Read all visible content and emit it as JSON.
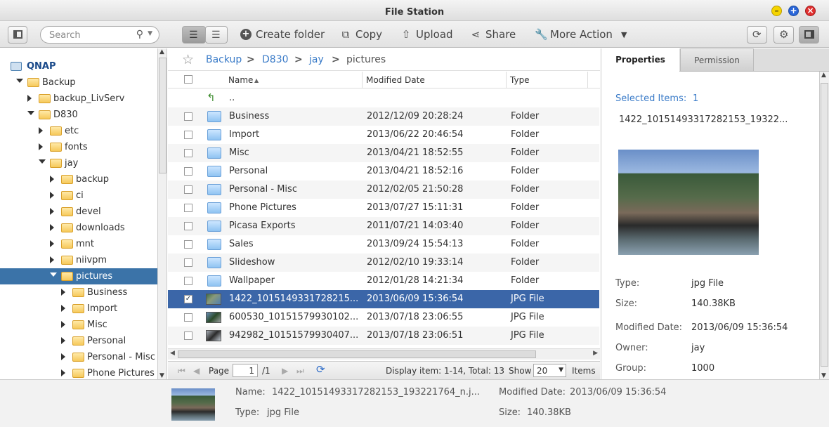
{
  "window": {
    "title": "File Station"
  },
  "toolbar": {
    "search_placeholder": "Search",
    "create_folder": "Create folder",
    "copy": "Copy",
    "upload": "Upload",
    "share": "Share",
    "more_action": "More Action"
  },
  "tree": {
    "root": "QNAP",
    "items": [
      {
        "label": "Backup"
      },
      {
        "label": "backup_LivServ"
      },
      {
        "label": "D830"
      },
      {
        "label": "etc"
      },
      {
        "label": "fonts"
      },
      {
        "label": "jay"
      },
      {
        "label": "backup"
      },
      {
        "label": "ci"
      },
      {
        "label": "devel"
      },
      {
        "label": "downloads"
      },
      {
        "label": "mnt"
      },
      {
        "label": "niivpm"
      },
      {
        "label": "pictures"
      },
      {
        "label": "Business"
      },
      {
        "label": "Import"
      },
      {
        "label": "Misc"
      },
      {
        "label": "Personal"
      },
      {
        "label": "Personal - Misc"
      },
      {
        "label": "Phone Pictures"
      }
    ]
  },
  "breadcrumb": [
    "Backup",
    "D830",
    "jay",
    "pictures"
  ],
  "breadcrumb_sep": ">",
  "table": {
    "headers": {
      "name": "Name",
      "modified": "Modified Date",
      "type": "Type"
    },
    "parent": "..",
    "rows": [
      {
        "name": "Business",
        "modified": "2012/12/09 20:28:24",
        "type": "Folder"
      },
      {
        "name": "Import",
        "modified": "2013/06/22 20:46:54",
        "type": "Folder"
      },
      {
        "name": "Misc",
        "modified": "2013/04/21 18:52:55",
        "type": "Folder"
      },
      {
        "name": "Personal",
        "modified": "2013/04/21 18:52:16",
        "type": "Folder"
      },
      {
        "name": "Personal - Misc",
        "modified": "2012/02/05 21:50:28",
        "type": "Folder"
      },
      {
        "name": "Phone Pictures",
        "modified": "2013/07/27 15:11:31",
        "type": "Folder"
      },
      {
        "name": "Picasa Exports",
        "modified": "2011/07/21 14:03:40",
        "type": "Folder"
      },
      {
        "name": "Sales",
        "modified": "2013/09/24 15:54:13",
        "type": "Folder"
      },
      {
        "name": "Slideshow",
        "modified": "2012/02/10 19:33:14",
        "type": "Folder"
      },
      {
        "name": "Wallpaper",
        "modified": "2012/01/28 14:21:34",
        "type": "Folder"
      },
      {
        "name": "1422_1015149331728215...",
        "modified": "2013/06/09 15:36:54",
        "type": "JPG File"
      },
      {
        "name": "600530_10151579930102...",
        "modified": "2013/07/18 23:06:55",
        "type": "JPG File"
      },
      {
        "name": "942982_10151579930407...",
        "modified": "2013/07/18 23:06:51",
        "type": "JPG File"
      }
    ]
  },
  "pager": {
    "page_label": "Page",
    "page": "1",
    "of": "/1",
    "display": "Display item: 1-14, Total: 13",
    "show_label": "Show",
    "show_value": "20",
    "items_label": "Items"
  },
  "properties": {
    "tab_properties": "Properties",
    "tab_permission": "Permission",
    "selected_label": "Selected Items:",
    "selected_count": "1",
    "filename": "1422_10151493317282153_19322...",
    "type_label": "Type:",
    "type_value": "jpg File",
    "size_label": "Size:",
    "size_value": "140.38KB",
    "modified_label": "Modified Date:",
    "modified_value": "2013/06/09 15:36:54",
    "owner_label": "Owner:",
    "owner_value": "jay",
    "group_label": "Group:",
    "group_value": "1000"
  },
  "bottom": {
    "name_label": "Name:",
    "name_value": "1422_10151493317282153_193221764_n.j...",
    "type_label": "Type:",
    "type_value": "jpg File",
    "modified_label": "Modified Date:",
    "modified_value": "2013/06/09 15:36:54",
    "size_label": "Size:",
    "size_value": "140.38KB"
  },
  "colors": {
    "selection": "#3b66a8",
    "link": "#3a7bc8"
  }
}
